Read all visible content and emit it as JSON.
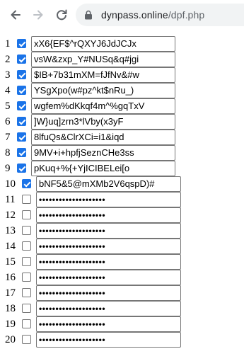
{
  "browser": {
    "back_icon": "arrow-left-icon",
    "forward_icon": "arrow-right-icon",
    "reload_icon": "reload-icon",
    "lock_icon": "lock-icon",
    "url_domain": "dynpass.online",
    "url_path": "/dpf.php"
  },
  "colors": {
    "checkbox_checked": "#1a73e8",
    "field_border": "#767676",
    "omnibox_bg": "#f1f3f4"
  },
  "rows": [
    {
      "number": "1",
      "checked": true,
      "value": "xX6{EF$^rQXYJ6JdJCJx"
    },
    {
      "number": "2",
      "checked": true,
      "value": "vsW&zxp_Y#NUSq&q#jgi"
    },
    {
      "number": "3",
      "checked": true,
      "value": "$IB+7b31mXM=fJfNv&#w"
    },
    {
      "number": "4",
      "checked": true,
      "value": "YSgXpo(w#pz^kt$nRu_)"
    },
    {
      "number": "5",
      "checked": true,
      "value": "wgfem%dKkqf4m^%gqTxV"
    },
    {
      "number": "6",
      "checked": true,
      "value": "]W}uq]zrn3*lVby(x3yF"
    },
    {
      "number": "7",
      "checked": true,
      "value": "8lfuQs&ClrXCi=i1&iqd"
    },
    {
      "number": "8",
      "checked": true,
      "value": "9MV+i+hpfjSeznCHe3ss"
    },
    {
      "number": "9",
      "checked": true,
      "value": "pKuq+%{+YjICIBELei[o"
    },
    {
      "number": "10",
      "checked": true,
      "value": "bNF5&5@mXMb2V6qspD)#"
    },
    {
      "number": "11",
      "checked": false,
      "value": "••••••••••••••••••••"
    },
    {
      "number": "12",
      "checked": false,
      "value": "••••••••••••••••••••"
    },
    {
      "number": "13",
      "checked": false,
      "value": "••••••••••••••••••••"
    },
    {
      "number": "14",
      "checked": false,
      "value": "••••••••••••••••••••"
    },
    {
      "number": "15",
      "checked": false,
      "value": "••••••••••••••••••••"
    },
    {
      "number": "16",
      "checked": false,
      "value": "••••••••••••••••••••"
    },
    {
      "number": "17",
      "checked": false,
      "value": "••••••••••••••••••••"
    },
    {
      "number": "18",
      "checked": false,
      "value": "••••••••••••••••••••"
    },
    {
      "number": "19",
      "checked": false,
      "value": "••••••••••••••••••••"
    },
    {
      "number": "20",
      "checked": false,
      "value": "••••••••••••••••••••"
    }
  ]
}
